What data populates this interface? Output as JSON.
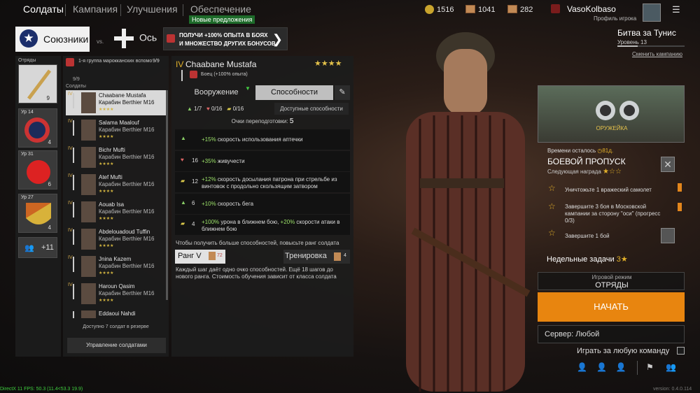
{
  "nav": {
    "tabs": [
      "Солдаты",
      "Кампания",
      "Улучшения",
      "Обеспечение"
    ],
    "new_offers": "Новые предложения"
  },
  "resources": {
    "silver": "1516",
    "tickets_a": "1041",
    "tickets_b": "282"
  },
  "profile": {
    "name": "VasoKolbaso",
    "label": "Профиль игрока",
    "battle": "Битва за Тунис",
    "level": "Уровень 13",
    "change": "Сменить кампанию"
  },
  "faction": {
    "allies": "Союзники",
    "vs": "vs.",
    "axis": "Ось"
  },
  "promo": {
    "line1": "ПОЛУЧИ +100% ОПЫТА В БОЯХ",
    "line2": "И МНОЖЕСТВО ДРУГИХ БОНУСОВ"
  },
  "squads": {
    "header": "Отряды",
    "cards": [
      {
        "level": "",
        "count": "9"
      },
      {
        "level": "Ур 14",
        "count": "4"
      },
      {
        "level": "Ур 31",
        "count": "6"
      },
      {
        "level": "Ур 27",
        "count": "4"
      }
    ],
    "more": "+11"
  },
  "squad_list": {
    "title": "1-я группа марокканских вспомо",
    "count": "9/9",
    "sub": "9/9",
    "header": "Солдаты",
    "soldiers": [
      {
        "name": "Chaabane Mustafa",
        "weapon": "Карабин Berthier M16",
        "rank": "IV"
      },
      {
        "name": "Salama Maalouf",
        "weapon": "Карабин Berthier M16",
        "rank": "IV"
      },
      {
        "name": "Bichr Mufti",
        "weapon": "Карабин Berthier M16",
        "rank": "IV"
      },
      {
        "name": "Atef Mufti",
        "weapon": "Карабин Berthier M16",
        "rank": "IV"
      },
      {
        "name": "Aouab Isa",
        "weapon": "Карабин Berthier M16",
        "rank": "IV"
      },
      {
        "name": "Abdelouadoud Tuffin",
        "weapon": "Карабин Berthier M16",
        "rank": "IV"
      },
      {
        "name": "Jnina Kazem",
        "weapon": "Карабин Berthier M16",
        "rank": "IV"
      },
      {
        "name": "Haroun Qasim",
        "weapon": "Карабин Berthier M16",
        "rank": "IV"
      },
      {
        "name": "Eddaoui Nahdi",
        "weapon": "",
        "rank": ""
      }
    ],
    "reserve": "Доступно 7 солдат в резерве",
    "manage": "Управление солдатами"
  },
  "detail": {
    "rank": "IV",
    "name": "Chaabane Mustafa",
    "stars": "★★★★",
    "class": "Боец",
    "bonus": "(+100% опыта)",
    "tab_weapons": "Вооружение",
    "tab_abilities": "Способности",
    "counts": {
      "a": "1/7",
      "b": "0/16",
      "c": "0/16"
    },
    "available": "Доступные способности",
    "retrain_label": "Очки переподготовки:",
    "retrain": "5",
    "skills": [
      {
        "n": "",
        "pre": "",
        "g": "+15%",
        "t": " скорость использования аптечки"
      },
      {
        "n": "16",
        "pre": "",
        "g": "+35%",
        "t": " живучести"
      },
      {
        "n": "12",
        "pre": "",
        "g": "+12%",
        "t": " скорость досылания патрона при стрельбе из винтовок с продольно скользящим затвором"
      },
      {
        "n": "6",
        "pre": "",
        "g": "+10%",
        "t": " скорость бега"
      },
      {
        "n": "4",
        "pre": "",
        "g": "+100%",
        "t": " урона в ближнем бою, ",
        "g2": "+20%",
        "t2": " скорости атаки в ближнем бою"
      }
    ],
    "hint": "Чтобы получить больше способностей, повысьте ранг солдата",
    "rank_btn": "Ранг V",
    "rank_cost": "72",
    "train_btn": "Тренировка",
    "train_cost": "4",
    "desc": "Каждый шаг даёт одно очко способностей. Ещё 18 шагов до нового ранга. Стоимость обучения зависит от класса солдата"
  },
  "battlepass": {
    "img_label": "ОРУЖЕЙКА",
    "time_label": "Времени осталось",
    "time": "81д.",
    "title": "БОЕВОЙ ПРОПУСК",
    "next": "Следующая награда",
    "tasks": [
      "Уничтожьте 1 вражеский самолет",
      "Завершите 3 боя в Московской кампании за сторону \"оси\" (прогресс 0/3)",
      "Завершите 1 бой"
    ],
    "weekly": "Недельные задачи",
    "weekly_count": "3"
  },
  "mode": {
    "label": "Игровой режим",
    "value": "ОТРЯДЫ",
    "start": "НАЧАТЬ",
    "server": "Сервер: Любой",
    "anyteam": "Играть за любую команду"
  },
  "footer": {
    "fps": "DirectX 11 FPS: 50.3 (11.4<53.3 19.9)",
    "version": "version: 0.4.0.114"
  }
}
